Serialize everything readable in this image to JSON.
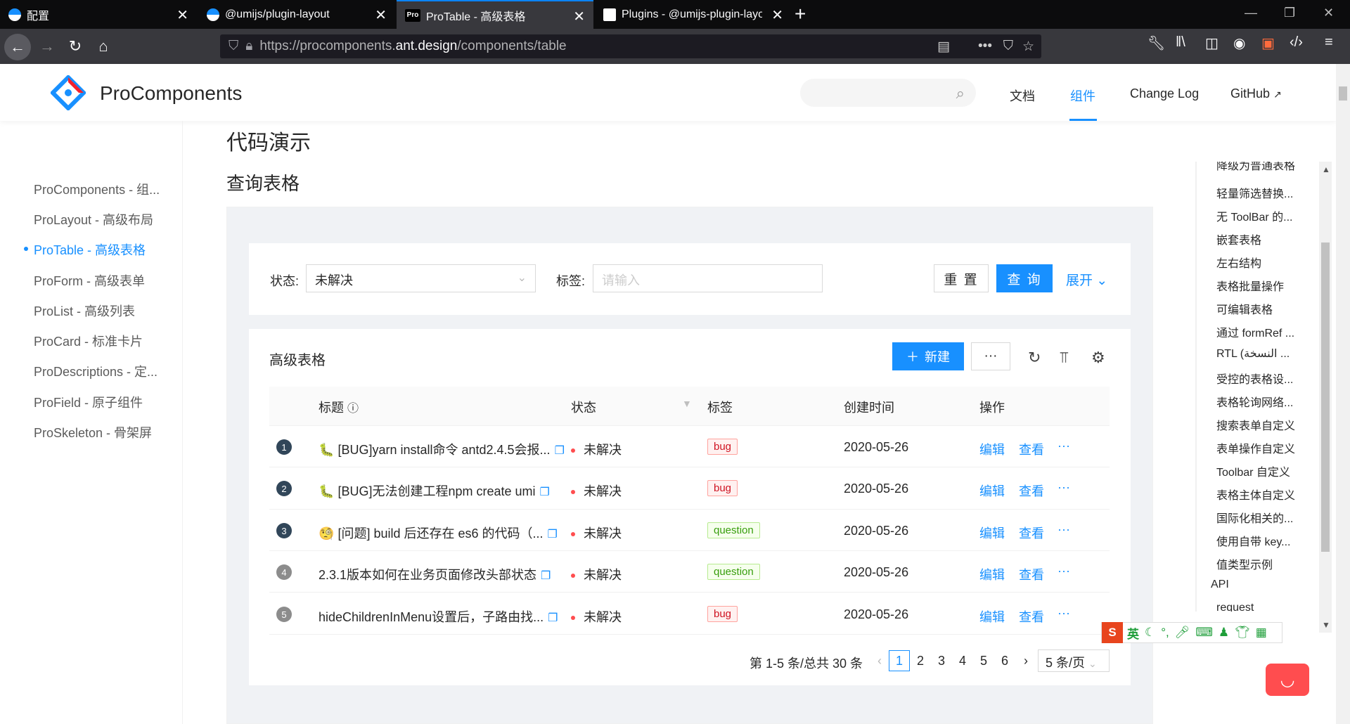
{
  "browser": {
    "tabs": [
      {
        "title": "配置"
      },
      {
        "title": "@umijs/plugin-layout"
      },
      {
        "title": "ProTable - 高级表格",
        "favicon": "Pro"
      },
      {
        "title": "Plugins - @umijs-plugin-layout"
      }
    ],
    "url_prefix": "https://procomponents.",
    "url_domain": "ant.design",
    "url_path": "/components/table"
  },
  "header": {
    "brand": "ProComponents",
    "menu": [
      "文档",
      "组件",
      "Change Log",
      "GitHub"
    ],
    "active_menu": "组件"
  },
  "sidebar": {
    "items": [
      "ProComponents - 组...",
      "ProLayout - 高级布局",
      "ProTable - 高级表格",
      "ProForm - 高级表单",
      "ProList - 高级列表",
      "ProCard - 标准卡片",
      "ProDescriptions - 定...",
      "ProField - 原子组件",
      "ProSkeleton - 骨架屏"
    ],
    "active_index": 2
  },
  "main": {
    "title": "代码演示",
    "subtitle": "查询表格"
  },
  "filter": {
    "status_label": "状态:",
    "status_value": "未解决",
    "tag_label": "标签:",
    "tag_placeholder": "请输入",
    "reset": "重 置",
    "query": "查 询",
    "expand": "展开"
  },
  "table": {
    "title": "高级表格",
    "new_button": "新建",
    "more_button": "···",
    "columns": [
      "标题",
      "状态",
      "标签",
      "创建时间",
      "操作"
    ],
    "rows": [
      {
        "index": "1",
        "emoji": "🐛",
        "title": "[BUG]yarn install命令 antd2.4.5会报...",
        "status": "未解决",
        "tag": "bug",
        "created": "2020-05-26"
      },
      {
        "index": "2",
        "emoji": "🐛",
        "title": "[BUG]无法创建工程npm create umi",
        "status": "未解决",
        "tag": "bug",
        "created": "2020-05-26"
      },
      {
        "index": "3",
        "emoji": "🧐",
        "title": "[问题] build 后还存在 es6 的代码（...",
        "status": "未解决",
        "tag": "question",
        "created": "2020-05-26"
      },
      {
        "index": "4",
        "emoji": "",
        "title": "2.3.1版本如何在业务页面修改头部状态",
        "status": "未解决",
        "tag": "question",
        "created": "2020-05-26"
      },
      {
        "index": "5",
        "emoji": "",
        "title": "hideChildrenInMenu设置后，子路由找...",
        "status": "未解决",
        "tag": "bug",
        "created": "2020-05-26"
      }
    ],
    "actions": {
      "edit": "编辑",
      "view": "查看",
      "more": "···"
    },
    "pagination": {
      "summary": "第 1-5 条/总共 30 条",
      "pages": [
        "1",
        "2",
        "3",
        "4",
        "5",
        "6"
      ],
      "current": "1",
      "page_size": "5 条/页"
    }
  },
  "anchor": {
    "items": [
      "降级为普通表格",
      "轻量筛选替换...",
      "无 ToolBar 的...",
      "嵌套表格",
      "左右结构",
      "表格批量操作",
      "可编辑表格",
      "通过 formRef ...",
      "RTL (النسخة ...",
      "受控的表格设...",
      "表格轮询网络...",
      "搜索表单自定义",
      "表单操作自定义",
      "Toolbar 自定义",
      "表格主体自定义",
      "国际化相关的...",
      "使用自带 key...",
      "值类型示例",
      "API",
      "request"
    ]
  },
  "ime": {
    "logo": "S",
    "lang": "英"
  },
  "colors": {
    "primary": "#1890ff",
    "danger": "#ff4d4f",
    "tab_bg": "#0c0c0d",
    "nav_bg": "#38383d"
  }
}
